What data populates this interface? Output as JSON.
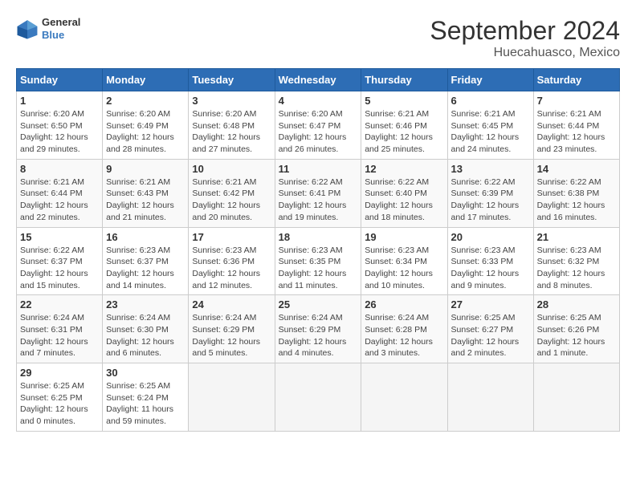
{
  "logo": {
    "line1": "General",
    "line2": "Blue"
  },
  "title": "September 2024",
  "subtitle": "Huecahuasco, Mexico",
  "days_header": [
    "Sunday",
    "Monday",
    "Tuesday",
    "Wednesday",
    "Thursday",
    "Friday",
    "Saturday"
  ],
  "weeks": [
    [
      {
        "day": "1",
        "info": "Sunrise: 6:20 AM\nSunset: 6:50 PM\nDaylight: 12 hours\nand 29 minutes."
      },
      {
        "day": "2",
        "info": "Sunrise: 6:20 AM\nSunset: 6:49 PM\nDaylight: 12 hours\nand 28 minutes."
      },
      {
        "day": "3",
        "info": "Sunrise: 6:20 AM\nSunset: 6:48 PM\nDaylight: 12 hours\nand 27 minutes."
      },
      {
        "day": "4",
        "info": "Sunrise: 6:20 AM\nSunset: 6:47 PM\nDaylight: 12 hours\nand 26 minutes."
      },
      {
        "day": "5",
        "info": "Sunrise: 6:21 AM\nSunset: 6:46 PM\nDaylight: 12 hours\nand 25 minutes."
      },
      {
        "day": "6",
        "info": "Sunrise: 6:21 AM\nSunset: 6:45 PM\nDaylight: 12 hours\nand 24 minutes."
      },
      {
        "day": "7",
        "info": "Sunrise: 6:21 AM\nSunset: 6:44 PM\nDaylight: 12 hours\nand 23 minutes."
      }
    ],
    [
      {
        "day": "8",
        "info": "Sunrise: 6:21 AM\nSunset: 6:44 PM\nDaylight: 12 hours\nand 22 minutes."
      },
      {
        "day": "9",
        "info": "Sunrise: 6:21 AM\nSunset: 6:43 PM\nDaylight: 12 hours\nand 21 minutes."
      },
      {
        "day": "10",
        "info": "Sunrise: 6:21 AM\nSunset: 6:42 PM\nDaylight: 12 hours\nand 20 minutes."
      },
      {
        "day": "11",
        "info": "Sunrise: 6:22 AM\nSunset: 6:41 PM\nDaylight: 12 hours\nand 19 minutes."
      },
      {
        "day": "12",
        "info": "Sunrise: 6:22 AM\nSunset: 6:40 PM\nDaylight: 12 hours\nand 18 minutes."
      },
      {
        "day": "13",
        "info": "Sunrise: 6:22 AM\nSunset: 6:39 PM\nDaylight: 12 hours\nand 17 minutes."
      },
      {
        "day": "14",
        "info": "Sunrise: 6:22 AM\nSunset: 6:38 PM\nDaylight: 12 hours\nand 16 minutes."
      }
    ],
    [
      {
        "day": "15",
        "info": "Sunrise: 6:22 AM\nSunset: 6:37 PM\nDaylight: 12 hours\nand 15 minutes."
      },
      {
        "day": "16",
        "info": "Sunrise: 6:23 AM\nSunset: 6:37 PM\nDaylight: 12 hours\nand 14 minutes."
      },
      {
        "day": "17",
        "info": "Sunrise: 6:23 AM\nSunset: 6:36 PM\nDaylight: 12 hours\nand 12 minutes."
      },
      {
        "day": "18",
        "info": "Sunrise: 6:23 AM\nSunset: 6:35 PM\nDaylight: 12 hours\nand 11 minutes."
      },
      {
        "day": "19",
        "info": "Sunrise: 6:23 AM\nSunset: 6:34 PM\nDaylight: 12 hours\nand 10 minutes."
      },
      {
        "day": "20",
        "info": "Sunrise: 6:23 AM\nSunset: 6:33 PM\nDaylight: 12 hours\nand 9 minutes."
      },
      {
        "day": "21",
        "info": "Sunrise: 6:23 AM\nSunset: 6:32 PM\nDaylight: 12 hours\nand 8 minutes."
      }
    ],
    [
      {
        "day": "22",
        "info": "Sunrise: 6:24 AM\nSunset: 6:31 PM\nDaylight: 12 hours\nand 7 minutes."
      },
      {
        "day": "23",
        "info": "Sunrise: 6:24 AM\nSunset: 6:30 PM\nDaylight: 12 hours\nand 6 minutes."
      },
      {
        "day": "24",
        "info": "Sunrise: 6:24 AM\nSunset: 6:29 PM\nDaylight: 12 hours\nand 5 minutes."
      },
      {
        "day": "25",
        "info": "Sunrise: 6:24 AM\nSunset: 6:29 PM\nDaylight: 12 hours\nand 4 minutes."
      },
      {
        "day": "26",
        "info": "Sunrise: 6:24 AM\nSunset: 6:28 PM\nDaylight: 12 hours\nand 3 minutes."
      },
      {
        "day": "27",
        "info": "Sunrise: 6:25 AM\nSunset: 6:27 PM\nDaylight: 12 hours\nand 2 minutes."
      },
      {
        "day": "28",
        "info": "Sunrise: 6:25 AM\nSunset: 6:26 PM\nDaylight: 12 hours\nand 1 minute."
      }
    ],
    [
      {
        "day": "29",
        "info": "Sunrise: 6:25 AM\nSunset: 6:25 PM\nDaylight: 12 hours\nand 0 minutes."
      },
      {
        "day": "30",
        "info": "Sunrise: 6:25 AM\nSunset: 6:24 PM\nDaylight: 11 hours\nand 59 minutes."
      },
      {
        "day": "",
        "info": ""
      },
      {
        "day": "",
        "info": ""
      },
      {
        "day": "",
        "info": ""
      },
      {
        "day": "",
        "info": ""
      },
      {
        "day": "",
        "info": ""
      }
    ]
  ]
}
